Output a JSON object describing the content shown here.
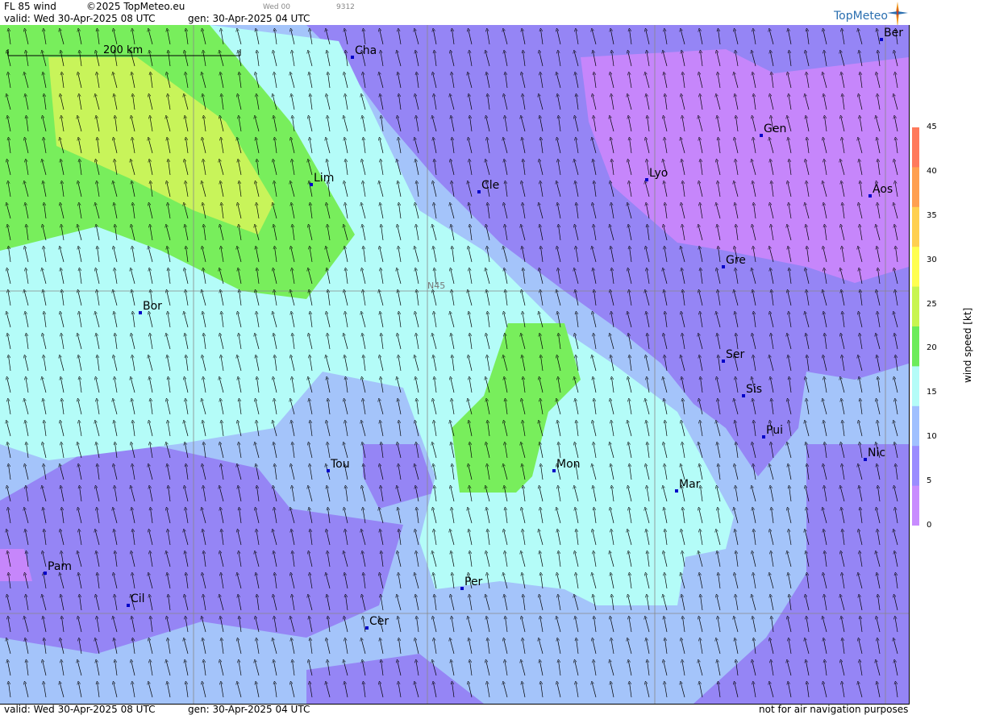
{
  "header": {
    "product": "FL 85 wind",
    "copyright": "©2025 TopMeteo.eu",
    "valid_label": "valid:  Wed  30-Apr-2025  08 UTC",
    "gen_label": "gen: 30-Apr-2025 04 UTC",
    "small_time": "Wed 00",
    "small_code": "9312"
  },
  "logo": {
    "text": "TopMeteo"
  },
  "scale_bar": {
    "label": "200 km"
  },
  "grid": {
    "lat_label": "N45"
  },
  "cities": [
    {
      "name": "Cha"
    },
    {
      "name": "Ber"
    },
    {
      "name": "Gen"
    },
    {
      "name": "Lim"
    },
    {
      "name": "Cle"
    },
    {
      "name": "Lyo"
    },
    {
      "name": "Aos"
    },
    {
      "name": "Gre"
    },
    {
      "name": "Bor"
    },
    {
      "name": "Ser"
    },
    {
      "name": "Sis"
    },
    {
      "name": "Pui"
    },
    {
      "name": "Nic"
    },
    {
      "name": "Tou"
    },
    {
      "name": "Mon"
    },
    {
      "name": "Mar"
    },
    {
      "name": "Pam"
    },
    {
      "name": "Per"
    },
    {
      "name": "Cil"
    },
    {
      "name": "Cer"
    }
  ],
  "legend": {
    "title": "wind  speed  [kt]",
    "ticks": [
      "45",
      "40",
      "35",
      "30",
      "25",
      "20",
      "15",
      "10",
      "5",
      "0"
    ],
    "colors": [
      "#ff7a5c",
      "#ffa050",
      "#ffd050",
      "#ffff50",
      "#c8f550",
      "#6cec5a",
      "#b4fcf8",
      "#a0c0ff",
      "#9a8cff",
      "#c88cff"
    ]
  },
  "footer": {
    "valid": "valid:  Wed  30-Apr-2025  08 UTC",
    "gen": "gen: 30-Apr-2025 04 UTC",
    "note": "not for air navigation purposes"
  },
  "map_colors": {
    "base": "#a4c4fa",
    "calm_purple": "#9585f5",
    "very_calm": "#c686fb",
    "cyan": "#b4fcf8",
    "green": "#78ee5c",
    "yellow_green": "#c8f45a"
  }
}
